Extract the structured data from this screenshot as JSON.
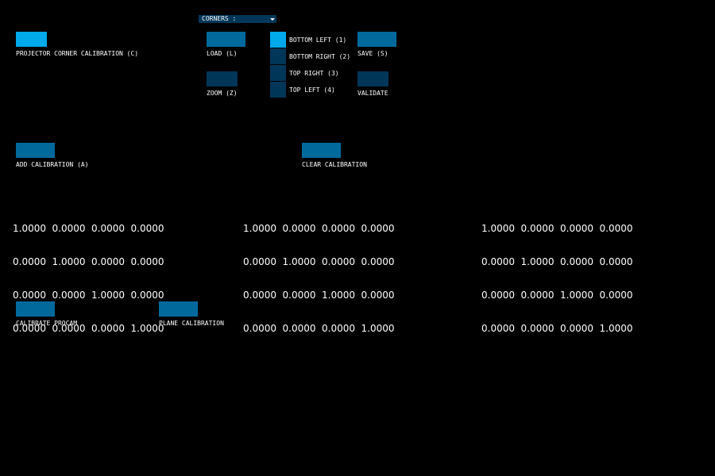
{
  "colors": {
    "background": "#000000",
    "button_active": "#00a9e9",
    "button_normal": "#02699d",
    "button_dark": "#003658",
    "text": "#ffffff"
  },
  "dropdown": {
    "label": "CORNERS :",
    "icon": "chevron-down-icon"
  },
  "buttons": {
    "projector_corner_calibration": "PROJECTOR CORNER CALIBRATION (C)",
    "load": "LOAD (L)",
    "save": "SAVE (S)",
    "zoom": "ZOOM (Z)",
    "validate": "VALIDATE",
    "add_calibration": "ADD CALIBRATION (A)",
    "clear_calibration": "CLEAR CALIBRATION",
    "calibrate_procam": "CALIBRATE PROCAM",
    "plane_calibration": "PLANE CALIBRATION"
  },
  "corners": {
    "selected_index": 0,
    "options": [
      "BOTTOM LEFT (1)",
      "BOTTOM RIGHT (2)",
      "TOP RIGHT (3)",
      "TOP LEFT (4)"
    ]
  },
  "matrices": [
    [
      [
        "1.0000",
        "0.0000",
        "0.0000",
        "0.0000"
      ],
      [
        "0.0000",
        "1.0000",
        "0.0000",
        "0.0000"
      ],
      [
        "0.0000",
        "0.0000",
        "1.0000",
        "0.0000"
      ],
      [
        "0.0000",
        "0.0000",
        "0.0000",
        "1.0000"
      ]
    ],
    [
      [
        "1.0000",
        "0.0000",
        "0.0000",
        "0.0000"
      ],
      [
        "0.0000",
        "1.0000",
        "0.0000",
        "0.0000"
      ],
      [
        "0.0000",
        "0.0000",
        "1.0000",
        "0.0000"
      ],
      [
        "0.0000",
        "0.0000",
        "0.0000",
        "1.0000"
      ]
    ],
    [
      [
        "1.0000",
        "0.0000",
        "0.0000",
        "0.0000"
      ],
      [
        "0.0000",
        "1.0000",
        "0.0000",
        "0.0000"
      ],
      [
        "0.0000",
        "0.0000",
        "1.0000",
        "0.0000"
      ],
      [
        "0.0000",
        "0.0000",
        "0.0000",
        "1.0000"
      ]
    ]
  ]
}
